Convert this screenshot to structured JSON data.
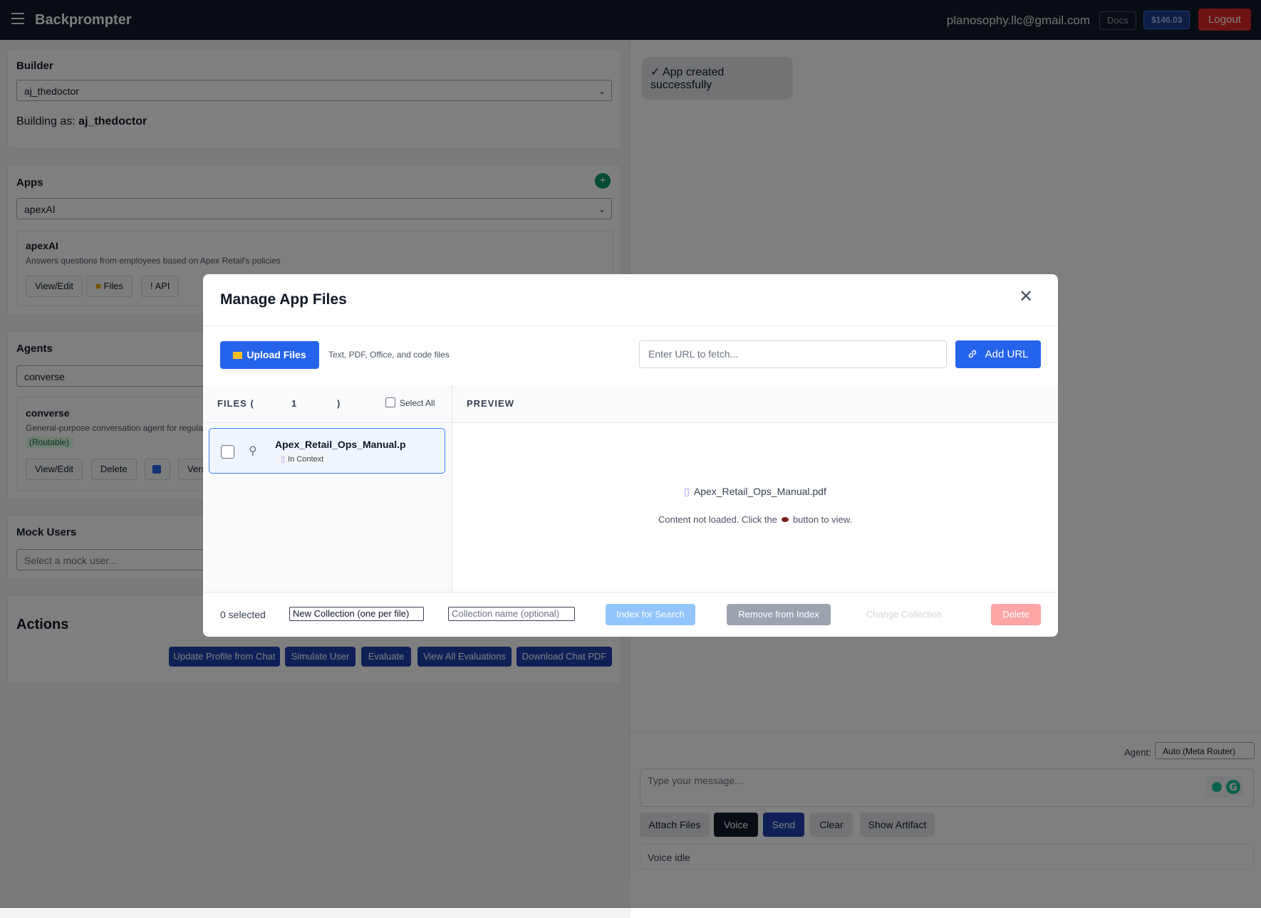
{
  "app": {
    "title": "Backprompter",
    "user_email": "planosophy.llc@gmail.com",
    "docs_label": "Docs",
    "credit_balance": "$146.03",
    "logout_label": "Logout"
  },
  "builder": {
    "title": "Builder",
    "selected": "aj_thedoctor",
    "building_as_prefix": "Building as: ",
    "building_as_name": "aj_thedoctor"
  },
  "apps": {
    "title": "Apps",
    "add_label": "+",
    "selected": "apexAI",
    "card": {
      "name": "apexAI",
      "description": "Answers questions from employees based on Apex Retail's policies",
      "buttons": [
        "View/Edit",
        "Files",
        "API"
      ]
    }
  },
  "agents": {
    "title": "Agents",
    "selected": "converse",
    "card": {
      "name": "converse",
      "description": "General-purpose conversation agent for regula",
      "tag": "(Routable)",
      "buttons": [
        "View/Edit",
        "Delete",
        "Versio"
      ]
    }
  },
  "mock_users": {
    "title": "Mock Users",
    "placeholder": "Select a mock user..."
  },
  "actions": {
    "title": "Actions",
    "buttons": [
      "Update Profile from Chat",
      "Simulate User",
      "Evaluate",
      "View All Evaluations",
      "Download Chat PDF"
    ]
  },
  "chat": {
    "success_message": "✓ App created successfully",
    "agent_label": "Agent:",
    "agent_selected": "Auto (Meta Router)",
    "input_placeholder": "Type your message...",
    "buttons": [
      "Attach Files",
      "Voice",
      "Send",
      "Clear",
      "Show Artifact"
    ],
    "voice_status": "Voice idle"
  },
  "modal": {
    "title": "Manage App Files",
    "close_label": "✕",
    "upload_label": "Upload Files",
    "upload_hint": "Text, PDF, Office, and code files",
    "url_placeholder": "Enter URL to fetch...",
    "add_url_label": "Add URL",
    "files_label": "FILES (",
    "files_count": "1",
    "files_close": ")",
    "select_all_label": "Select All",
    "file": {
      "name": "Apex_Retail_Ops_Manual.p",
      "status": "In Context"
    },
    "preview_label": "PREVIEW",
    "preview_filename": "Apex_Retail_Ops_Manual.pdf",
    "preview_msg_before": "Content not loaded. Click the",
    "preview_msg_after": "button to view.",
    "selected_count": "0 selected",
    "collection_mode": "New Collection (one per file)",
    "collection_name_placeholder": "Collection name (optional)",
    "index_label": "Index for Search",
    "remove_label": "Remove from Index",
    "change_label": "Change Collection",
    "delete_label": "Delete"
  },
  "colors": {
    "topbar": "#111827",
    "primary": "#2563eb",
    "action": "#1e40af",
    "danger": "#dc2626",
    "success": "#059669"
  }
}
